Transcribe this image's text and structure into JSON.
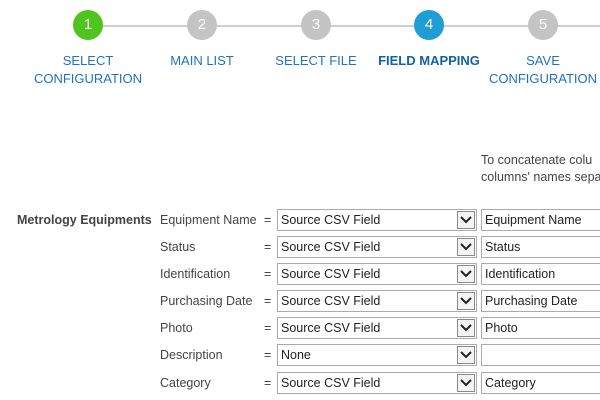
{
  "wizard": {
    "steps": [
      {
        "number": "1",
        "label_line1": "SELECT",
        "label_line2": "CONFIGURATION",
        "state": "done"
      },
      {
        "number": "2",
        "label_line1": "MAIN LIST",
        "label_line2": "",
        "state": "todo"
      },
      {
        "number": "3",
        "label_line1": "SELECT FILE",
        "label_line2": "",
        "state": "todo"
      },
      {
        "number": "4",
        "label_line1": "FIELD MAPPING",
        "label_line2": "",
        "state": "current"
      },
      {
        "number": "5",
        "label_line1": "SAVE",
        "label_line2": "CONFIGURATION",
        "state": "todo"
      }
    ],
    "colors": {
      "done": "#4fc41c",
      "current": "#1e9ed4",
      "todo": "#c4c4c4"
    }
  },
  "hint": {
    "line1": "To concatenate colu",
    "line2": "columns' names sepa"
  },
  "mapping": {
    "group_label": "Metrology Equipments",
    "equals": "=",
    "rows": [
      {
        "field": "Equipment Name",
        "source": "Source CSV Field",
        "column": "Equipment Name"
      },
      {
        "field": "Status",
        "source": "Source CSV Field",
        "column": "Status"
      },
      {
        "field": "Identification",
        "source": "Source CSV Field",
        "column": "Identification"
      },
      {
        "field": "Purchasing Date",
        "source": "Source CSV Field",
        "column": "Purchasing Date"
      },
      {
        "field": "Photo",
        "source": "Source CSV Field",
        "column": "Photo"
      },
      {
        "field": "Description",
        "source": "None",
        "column": ""
      },
      {
        "field": "Category",
        "source": "Source CSV Field",
        "column": "Category"
      }
    ]
  }
}
